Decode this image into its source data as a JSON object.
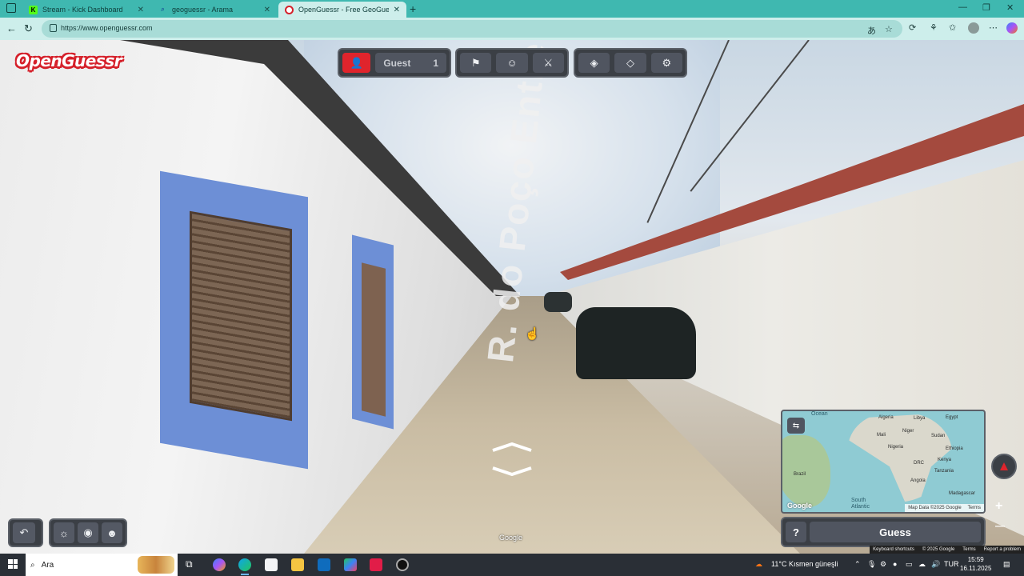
{
  "browser": {
    "tabs": [
      {
        "title": "Stream - Kick Dashboard",
        "icon": "kick-icon",
        "active": false
      },
      {
        "title": "geoguessr - Arama",
        "icon": "search-icon",
        "active": false
      },
      {
        "title": "OpenGuessr - Free GeoGuessr Alt",
        "icon": "openguessr-icon",
        "active": true
      }
    ],
    "new_tab": "+",
    "url": "https://www.openguessr.com",
    "controls": {
      "minimize": "—",
      "restore": "❐",
      "close": "✕"
    }
  },
  "app": {
    "logo": "OpenGuessr",
    "player": {
      "name": "Guest",
      "count": "1"
    },
    "street_text": "R. do Poço Entre",
    "google_mark": "Google",
    "guess_button": "Guess",
    "help_button": "?",
    "zoom_in": "+",
    "zoom_out": "—"
  },
  "minimap": {
    "labels": {
      "ocean_top": "Ocean",
      "algeria": "Algeria",
      "libya": "Libya",
      "egypt": "Egypt",
      "mali": "Mali",
      "niger": "Niger",
      "sudan": "Sudan",
      "nigeria": "Nigeria",
      "ethiopia": "Ethiopia",
      "kenya": "Kenya",
      "drc": "DRC",
      "tanzania": "Tanzania",
      "brazil": "Brazil",
      "angola": "Angola",
      "madagascar": "Madagascar",
      "south_atlantic": "South Atlantic"
    },
    "google_logo": "Google",
    "footer": {
      "map_data": "Map Data ©2025 Google",
      "terms": "Terms"
    }
  },
  "attribution": {
    "keyboard": "Keyboard shortcuts",
    "copyright": "© 2025 Google",
    "terms": "Terms",
    "report": "Report a problem"
  },
  "taskbar": {
    "search_placeholder": "Ara",
    "weather": "11°C  Kısmen güneşli",
    "language": "TUR",
    "time": "15:59",
    "date": "16.11.2025"
  }
}
